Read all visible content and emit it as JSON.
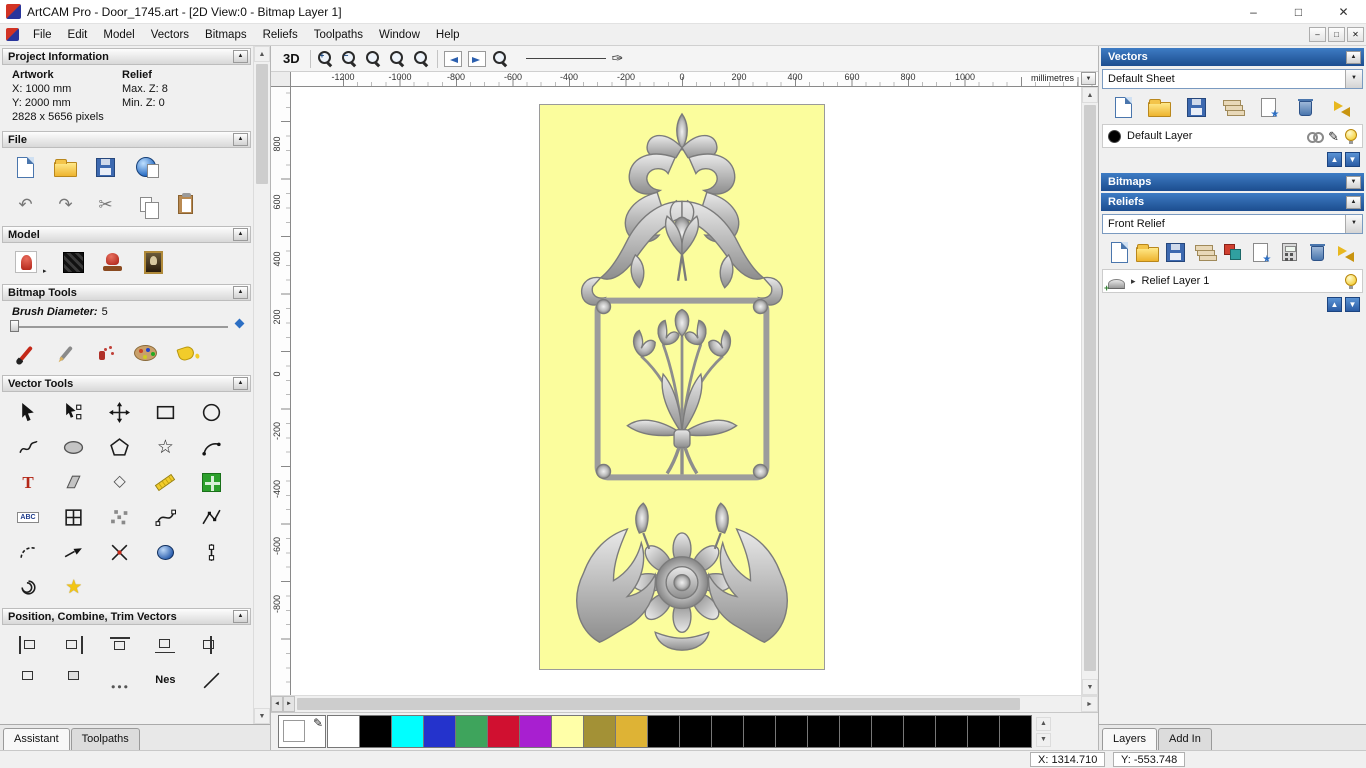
{
  "icons": {
    "up": "▲",
    "down": "▼",
    "left": "◄",
    "right": "►",
    "minimize": "–",
    "maximize": "□",
    "close": "✕",
    "undo": "↶",
    "redo": "↷",
    "cut": "✂",
    "pencil": "✎",
    "expand": "▸",
    "dropdown": "▼",
    "plus": "+",
    "minus": "−",
    "star_outline": "☆",
    "star": "★",
    "diamond": "◇",
    "text_tool": "T",
    "abc": "ABC",
    "pen": "✑"
  },
  "window": {
    "title": "ArtCAM Pro - Door_1745.art - [2D View:0 - Bitmap Layer 1]"
  },
  "menu": {
    "items": [
      "File",
      "Edit",
      "Model",
      "Vectors",
      "Bitmaps",
      "Reliefs",
      "Toolpaths",
      "Window",
      "Help"
    ]
  },
  "left_panel": {
    "project_info": {
      "title": "Project Information",
      "artwork_label": "Artwork",
      "relief_label": "Relief",
      "x_value": "X: 1000 mm",
      "y_value": "Y: 2000 mm",
      "max_z": "Max. Z: 8",
      "min_z": "Min. Z: 0",
      "pixels": "2828 x 5656 pixels"
    },
    "file_title": "File",
    "model_title": "Model",
    "bitmap_tools_title": "Bitmap Tools",
    "brush_label": "Brush Diameter:",
    "brush_value": "5",
    "vector_tools_title": "Vector Tools",
    "position_title": "Position, Combine, Trim Vectors",
    "nesting_label": "Nes",
    "tabs": {
      "assistant": "Assistant",
      "toolpaths": "Toolpaths"
    }
  },
  "canvas": {
    "view_toggle": "3D",
    "ruler_h": [
      "-1200",
      "-1000",
      "-800",
      "-600",
      "-400",
      "-200",
      "0",
      "200",
      "400",
      "600",
      "800",
      "1000"
    ],
    "ruler_unit": "millimetres",
    "ruler_v": [
      "800",
      "600",
      "400",
      "200",
      "0",
      "-200",
      "-400",
      "-600",
      "-800"
    ]
  },
  "right_panel": {
    "vectors": {
      "title": "Vectors",
      "sheet_value": "Default Sheet",
      "layer_name": "Default Layer"
    },
    "bitmaps": {
      "title": "Bitmaps"
    },
    "reliefs": {
      "title": "Reliefs",
      "selected_value": "Front Relief",
      "layer_name": "Relief Layer 1"
    },
    "tabs": {
      "layers": "Layers",
      "addin": "Add In"
    }
  },
  "palette": {
    "colors": [
      "#ffffff",
      "#000000",
      "#00ffff",
      "#2433cc",
      "#3ea45c",
      "#d01030",
      "#a81fd0",
      "#ffffa8",
      "#a39136",
      "#deb335",
      "#000000",
      "#000000",
      "#000000",
      "#000000",
      "#000000",
      "#000000",
      "#000000",
      "#000000",
      "#000000",
      "#000000",
      "#000000",
      "#000000"
    ]
  },
  "status": {
    "x": "X: 1314.710",
    "y": "Y: -553.748"
  }
}
